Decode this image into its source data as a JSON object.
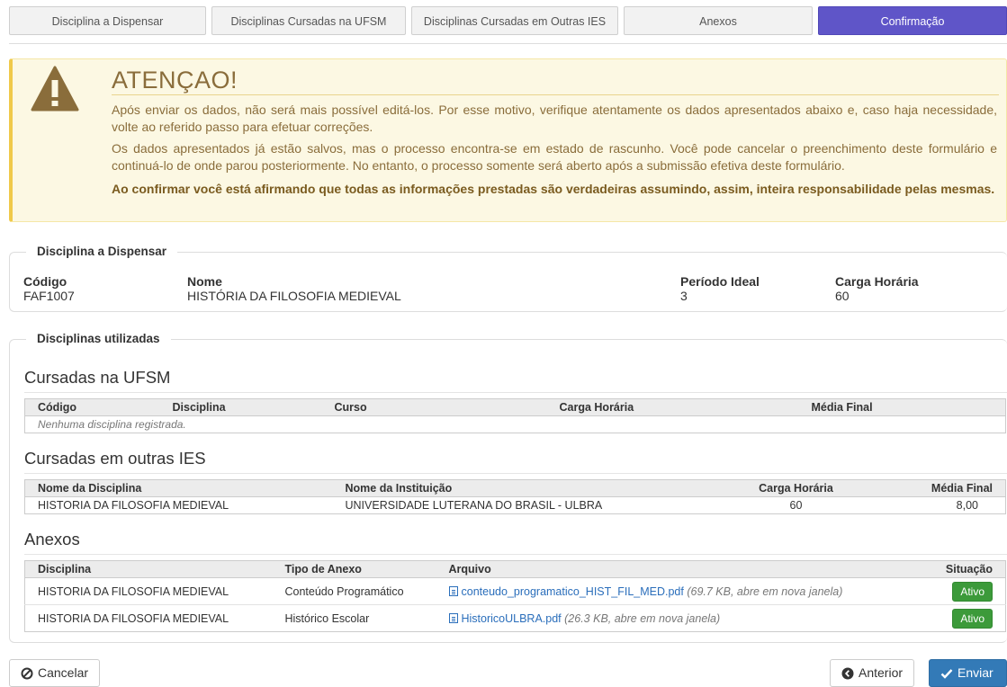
{
  "steps": [
    {
      "label": "Disciplina a Dispensar",
      "active": false
    },
    {
      "label": "Disciplinas Cursadas na UFSM",
      "active": false
    },
    {
      "label": "Disciplinas Cursadas em Outras IES",
      "active": false
    },
    {
      "label": "Anexos",
      "active": false
    },
    {
      "label": "Confirmação",
      "active": true
    }
  ],
  "alert": {
    "icon": "warning-triangle-icon",
    "title": "ATENÇAO!",
    "p1": "Após enviar os dados, não será mais possível editá-los. Por esse motivo, verifique atentamente os dados apresentados abaixo e, caso haja necessidade, volte ao referido passo para efetuar correções.",
    "p2": "Os dados apresentados já estão salvos, mas o processo encontra-se em estado de rascunho. Você pode cancelar o preenchimento deste formulário e continuá-lo de onde parou posteriormente. No entanto, o processo somente será aberto após a submissão efetiva deste formulário.",
    "p3": "Ao confirmar você está afirmando que todas as informações prestadas são verdadeiras assumindo, assim, inteira responsabilidade pelas mesmas.",
    "color": "#8a6d3b"
  },
  "dispensar": {
    "legend": "Disciplina a Dispensar",
    "codigo_label": "Código",
    "codigo": "FAF1007",
    "nome_label": "Nome",
    "nome": "HISTÓRIA DA FILOSOFIA MEDIEVAL",
    "periodo_label": "Período Ideal",
    "periodo": "3",
    "carga_label": "Carga Horária",
    "carga": "60"
  },
  "utilizadas": {
    "legend": "Disciplinas utilizadas",
    "ufsm": {
      "title": "Cursadas na UFSM",
      "headers": [
        "Código",
        "Disciplina",
        "Curso",
        "Carga Horária",
        "Média Final"
      ],
      "empty": "Nenhuma disciplina registrada."
    },
    "outras": {
      "title": "Cursadas em outras IES",
      "headers": [
        "Nome da Disciplina",
        "Nome da Instituição",
        "Carga Horária",
        "Média Final"
      ],
      "rows": [
        [
          "HISTORIA DA FILOSOFIA MEDIEVAL",
          "UNIVERSIDADE LUTERANA DO BRASIL - ULBRA",
          "60",
          "8,00"
        ]
      ]
    },
    "anexos": {
      "title": "Anexos",
      "headers": [
        "Disciplina",
        "Tipo de Anexo",
        "Arquivo",
        "Situação"
      ],
      "rows": [
        {
          "disciplina": "HISTORIA DA FILOSOFIA MEDIEVAL",
          "tipo": "Conteúdo Programático",
          "arquivo": "conteudo_programatico_HIST_FIL_MED.pdf",
          "meta": "(69.7 KB, abre em nova janela)",
          "situacao": "Ativo"
        },
        {
          "disciplina": "HISTORIA DA FILOSOFIA MEDIEVAL",
          "tipo": "Histórico Escolar",
          "arquivo": "HistoricoULBRA.pdf",
          "meta": "(26.3 KB, abre em nova janela)",
          "situacao": "Ativo"
        }
      ]
    }
  },
  "footer": {
    "cancel": "Cancelar",
    "previous": "Anterior",
    "submit": "Enviar"
  },
  "colors": {
    "active_step": "#5f55c8",
    "alert_bg": "#fcf8e3",
    "badge_green": "#3c9a3a",
    "primary_button": "#337ab7"
  }
}
